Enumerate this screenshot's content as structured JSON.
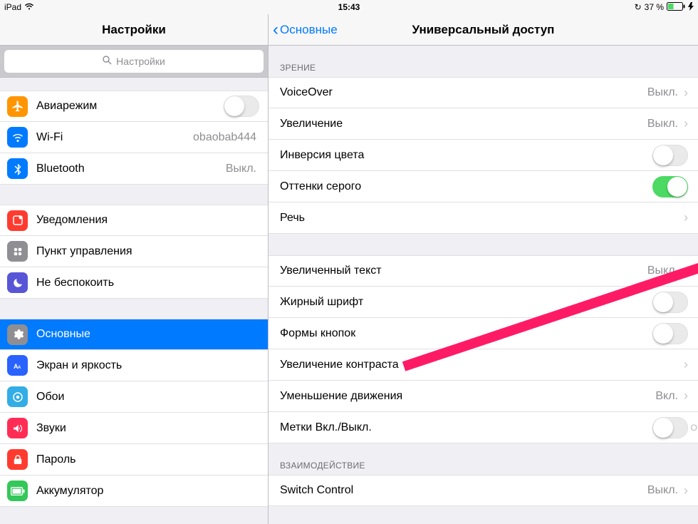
{
  "status": {
    "device": "iPad",
    "time": "15:43",
    "battery": "37 %"
  },
  "sidebar": {
    "title": "Настройки",
    "search_placeholder": "Настройки",
    "groups": [
      {
        "items": [
          {
            "name": "airplane",
            "label": "Авиарежим",
            "icon": "airplane-icon",
            "bg": "bg-orange",
            "type": "toggle",
            "on": false
          },
          {
            "name": "wifi",
            "label": "Wi-Fi",
            "icon": "wifi-icon",
            "bg": "bg-blue",
            "type": "nav",
            "value": "obaobab444"
          },
          {
            "name": "bluetooth",
            "label": "Bluetooth",
            "icon": "bluetooth-icon",
            "bg": "bg-blue",
            "type": "nav",
            "value": "Выкл."
          }
        ]
      },
      {
        "items": [
          {
            "name": "notifications",
            "label": "Уведомления",
            "icon": "notifications-icon",
            "bg": "bg-red",
            "type": "nav"
          },
          {
            "name": "control-center",
            "label": "Пункт управления",
            "icon": "control-center-icon",
            "bg": "bg-gray",
            "type": "nav"
          },
          {
            "name": "dnd",
            "label": "Не беспокоить",
            "icon": "moon-icon",
            "bg": "bg-purple",
            "type": "nav"
          }
        ]
      },
      {
        "items": [
          {
            "name": "general",
            "label": "Основные",
            "icon": "gear-icon",
            "bg": "bg-gray",
            "type": "nav",
            "selected": true
          },
          {
            "name": "display",
            "label": "Экран и яркость",
            "icon": "display-icon",
            "bg": "bg-deepblue",
            "type": "nav"
          },
          {
            "name": "wallpaper",
            "label": "Обои",
            "icon": "wallpaper-icon",
            "bg": "bg-cyan",
            "type": "nav"
          },
          {
            "name": "sounds",
            "label": "Звуки",
            "icon": "sounds-icon",
            "bg": "bg-pink",
            "type": "nav"
          },
          {
            "name": "passcode",
            "label": "Пароль",
            "icon": "passcode-icon",
            "bg": "bg-red",
            "type": "nav"
          },
          {
            "name": "battery",
            "label": "Аккумулятор",
            "icon": "battery-icon",
            "bg": "bg-green",
            "type": "nav"
          }
        ]
      }
    ]
  },
  "detail": {
    "back": "Основные",
    "title": "Универсальный доступ",
    "sections": [
      {
        "header": "ЗРЕНИЕ",
        "items": [
          {
            "name": "voiceover",
            "label": "VoiceOver",
            "type": "nav",
            "value": "Выкл."
          },
          {
            "name": "zoom",
            "label": "Увеличение",
            "type": "nav",
            "value": "Выкл."
          },
          {
            "name": "invert-colors",
            "label": "Инверсия цвета",
            "type": "toggle",
            "on": false
          },
          {
            "name": "grayscale",
            "label": "Оттенки серого",
            "type": "toggle",
            "on": true
          },
          {
            "name": "speech",
            "label": "Речь",
            "type": "nav"
          }
        ]
      },
      {
        "header": "",
        "items": [
          {
            "name": "larger-text",
            "label": "Увеличенный текст",
            "type": "nav",
            "value": "Выкл."
          },
          {
            "name": "bold-text",
            "label": "Жирный шрифт",
            "type": "toggle",
            "on": false
          },
          {
            "name": "button-shapes",
            "label": "Формы кнопок",
            "type": "toggle",
            "on": false
          },
          {
            "name": "increase-contrast",
            "label": "Увеличение контраста",
            "type": "nav"
          },
          {
            "name": "reduce-motion",
            "label": "Уменьшение движения",
            "type": "nav",
            "value": "Вкл."
          },
          {
            "name": "on-off-labels",
            "label": "Метки Вкл./Выкл.",
            "type": "toggle",
            "on": false,
            "labeled": true
          }
        ]
      },
      {
        "header": "ВЗАИМОДЕЙСТВИЕ",
        "items": [
          {
            "name": "switch-control",
            "label": "Switch Control",
            "type": "nav",
            "value": "Выкл."
          }
        ]
      }
    ]
  }
}
